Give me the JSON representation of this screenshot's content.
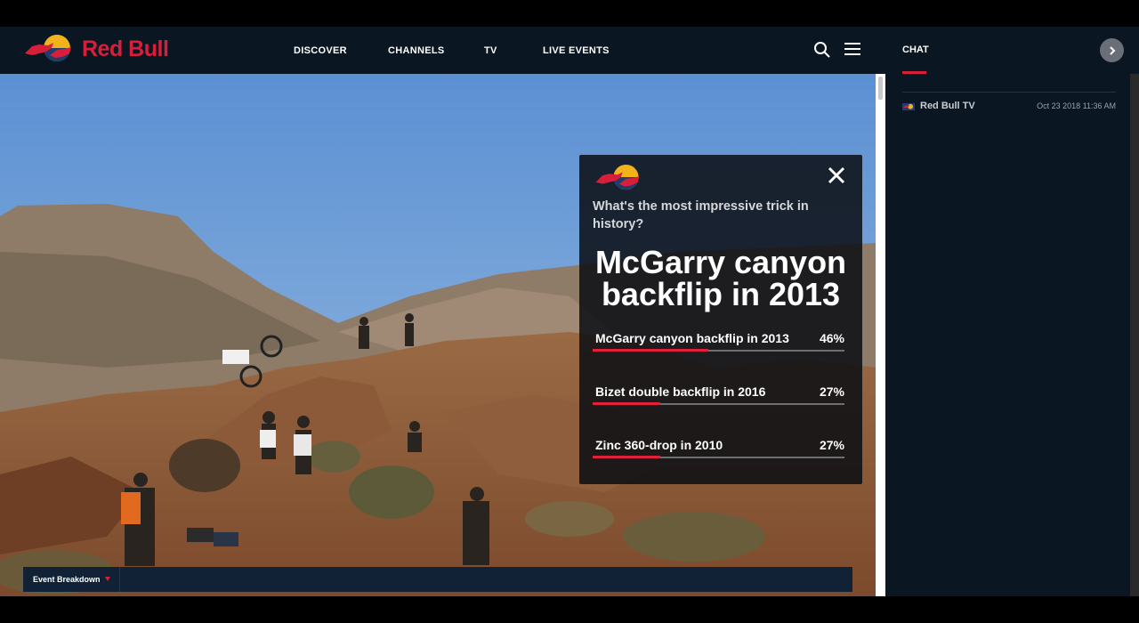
{
  "brand": {
    "name": "Red Bull",
    "accent": "#d81f3a",
    "bg": "#0b1623"
  },
  "nav": {
    "items": [
      {
        "label": "DISCOVER"
      },
      {
        "label": "CHANNELS"
      },
      {
        "label": "TV"
      },
      {
        "label": "LIVE EVENTS"
      }
    ],
    "icons": [
      "search-icon",
      "menu-icon"
    ]
  },
  "chat": {
    "tab_label": "CHAT",
    "collapse_icon": "chevron-right-icon",
    "messages": [
      {
        "author": "Red Bull TV",
        "time": "Oct 23 2018 11:36 AM"
      }
    ]
  },
  "poll": {
    "close_icon": "close-icon",
    "question": "What's the most impressive trick in history?",
    "answer_line1": "McGarry canyon",
    "answer_line2": "backflip in 2013",
    "options": [
      {
        "label": "McGarry canyon backflip in 2013",
        "percent_text": "46%",
        "percent": 46
      },
      {
        "label": "Bizet double backflip in 2016",
        "percent_text": "27%",
        "percent": 27
      },
      {
        "label": "Zinc 360-drop in 2010",
        "percent_text": "27%",
        "percent": 27
      }
    ]
  },
  "bottom_bar": {
    "label": "Event Breakdown"
  }
}
